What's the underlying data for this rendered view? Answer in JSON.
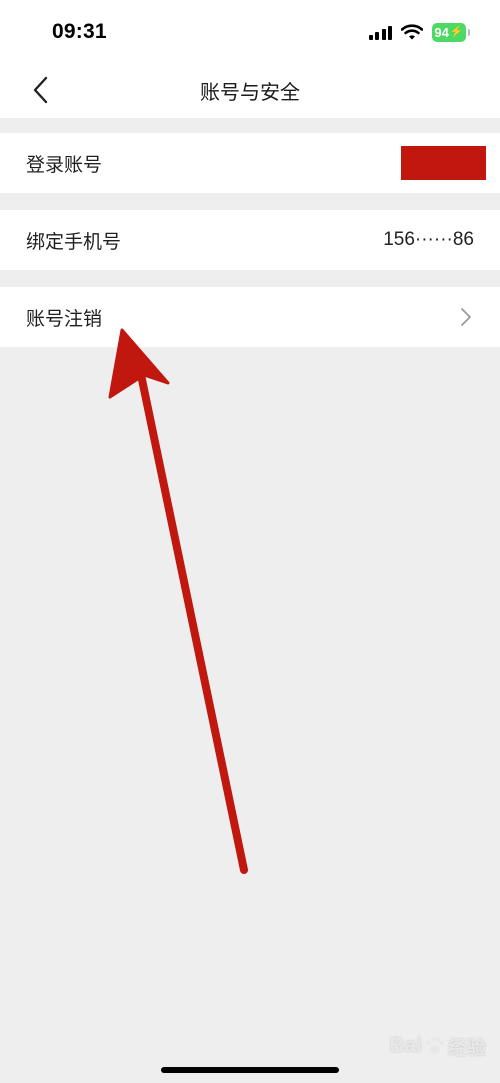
{
  "status_bar": {
    "time": "09:31",
    "battery": "94",
    "battery_color": "#4cd964"
  },
  "nav": {
    "title": "账号与安全",
    "back_icon": "chevron-left-icon"
  },
  "settings": {
    "login_account": {
      "label": "登录账号",
      "value_redacted": true,
      "redact_color": "#c0170f"
    },
    "bound_phone": {
      "label": "绑定手机号",
      "value": "156······86"
    },
    "account_cancel": {
      "label": "账号注销",
      "icon": "chevron-right-icon"
    }
  },
  "annotation": {
    "arrow_color": "#c0170f"
  },
  "watermark": {
    "part1": "Bai",
    "part2": "经验"
  }
}
